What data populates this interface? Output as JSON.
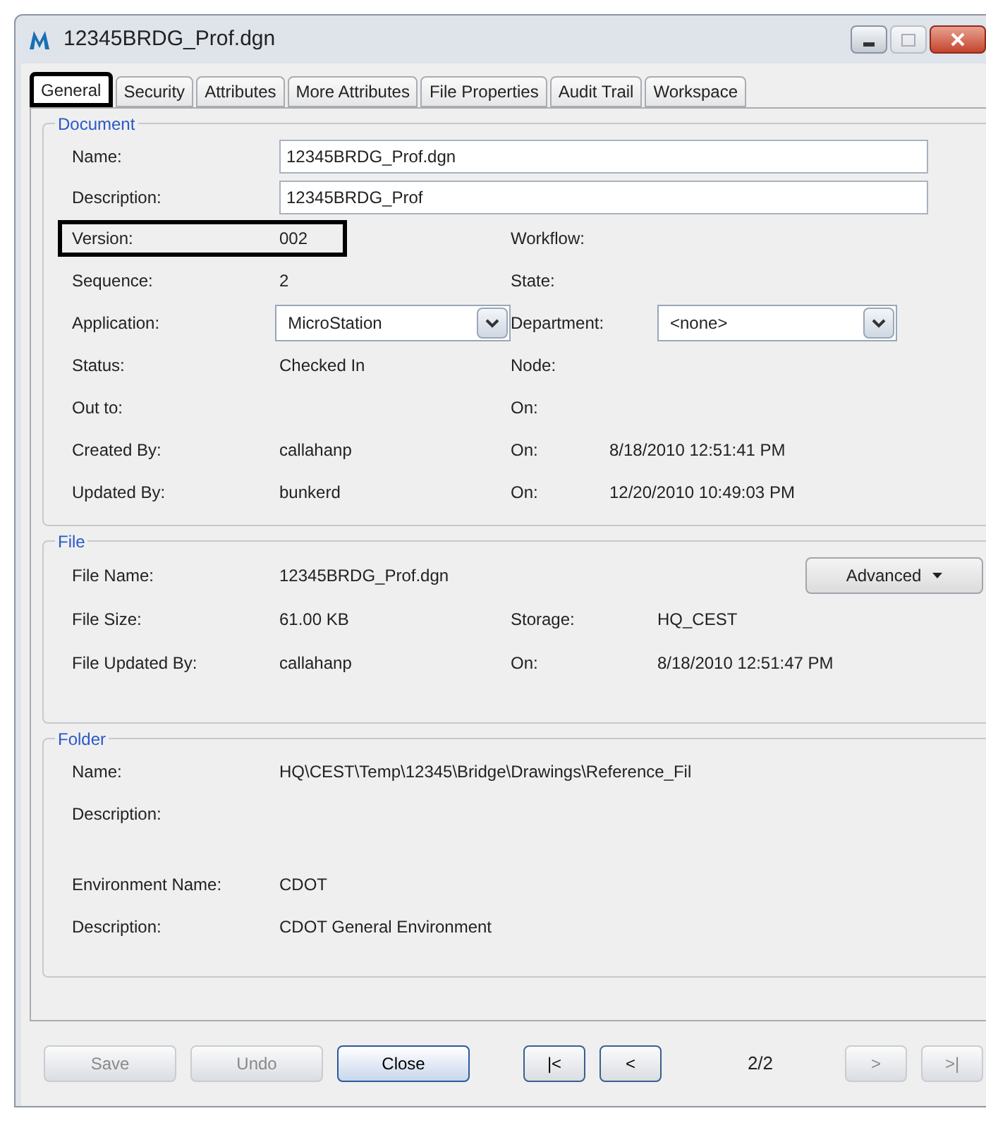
{
  "window": {
    "title": "12345BRDG_Prof.dgn"
  },
  "tabs": [
    {
      "label": "General",
      "selected": true,
      "highlighted": true
    },
    {
      "label": "Security",
      "selected": false,
      "highlighted": false
    },
    {
      "label": "Attributes",
      "selected": false,
      "highlighted": false
    },
    {
      "label": "More Attributes",
      "selected": false,
      "highlighted": false
    },
    {
      "label": "File Properties",
      "selected": false,
      "highlighted": false
    },
    {
      "label": "Audit Trail",
      "selected": false,
      "highlighted": false
    },
    {
      "label": "Workspace",
      "selected": false,
      "highlighted": false
    }
  ],
  "document": {
    "title": "Document",
    "inputs": [
      {
        "label": "Name:",
        "value": "12345BRDG_Prof.dgn"
      },
      {
        "label": "Description:",
        "value": "12345BRDG_Prof"
      }
    ],
    "rows": [
      {
        "left": {
          "label": "Version:",
          "value": "002",
          "kind": "text",
          "highlighted": true
        },
        "right": {
          "label": "Workflow:",
          "kind": "text"
        }
      },
      {
        "left": {
          "label": "Sequence:",
          "value": "2",
          "kind": "text",
          "highlighted": false
        },
        "right": {
          "label": "State:",
          "kind": "text"
        }
      },
      {
        "left": {
          "label": "Application:",
          "value": "MicroStation",
          "kind": "dropdown",
          "highlighted": false
        },
        "right": {
          "label": "Department:",
          "value": "<none>",
          "kind": "dropdown"
        }
      },
      {
        "left": {
          "label": "Status:",
          "value": "Checked In",
          "kind": "text",
          "highlighted": false
        },
        "right": {
          "label": "Node:",
          "kind": "text"
        }
      },
      {
        "left": {
          "label": "Out to:",
          "kind": "text",
          "highlighted": false
        },
        "right": {
          "label": "On:",
          "kind": "text"
        }
      },
      {
        "left": {
          "label": "Created By:",
          "value": "callahanp",
          "kind": "text",
          "highlighted": false
        },
        "right": {
          "label": "On:",
          "value": "8/18/2010 12:51:41 PM",
          "kind": "text"
        }
      },
      {
        "left": {
          "label": "Updated By:",
          "value": "bunkerd",
          "kind": "text",
          "highlighted": false
        },
        "right": {
          "label": "On:",
          "value": "12/20/2010 10:49:03 PM",
          "kind": "text"
        }
      }
    ]
  },
  "file": {
    "title": "File",
    "rows": [
      {
        "left": {
          "label": "File Name:",
          "value": "12345BRDG_Prof.dgn"
        },
        "right": {
          "kind": "button",
          "label": "Advanced"
        }
      },
      {
        "left": {
          "label": "File Size:",
          "value": "61.00 KB"
        },
        "right": {
          "kind": "text",
          "label": "Storage:",
          "value": "HQ_CEST"
        }
      },
      {
        "left": {
          "label": "File Updated By:",
          "value": "callahanp"
        },
        "right": {
          "kind": "text",
          "label": "On:",
          "value": "8/18/2010 12:51:47 PM"
        }
      }
    ]
  },
  "folder": {
    "title": "Folder",
    "sections": [
      [
        {
          "label": "Name:",
          "value": "HQ\\CEST\\Temp\\12345\\Bridge\\Drawings\\Reference_Fil"
        },
        {
          "label": "Description:"
        }
      ],
      [
        {
          "label": "Environment Name:",
          "value": "CDOT"
        },
        {
          "label": "Description:",
          "value": "CDOT General Environment"
        }
      ]
    ]
  },
  "footer": [
    {
      "kind": "button",
      "label": "Save",
      "disabled": true,
      "default": false
    },
    {
      "kind": "button",
      "label": "Undo",
      "disabled": true,
      "default": false
    },
    {
      "kind": "button",
      "label": "Close",
      "disabled": false,
      "default": true
    },
    {
      "kind": "button",
      "label": "|<",
      "disabled": false,
      "default": false
    },
    {
      "kind": "button",
      "label": "<",
      "disabled": false,
      "default": false
    },
    {
      "kind": "counter",
      "text": "2/2"
    },
    {
      "kind": "button",
      "label": ">",
      "disabled": true,
      "default": false
    },
    {
      "kind": "button",
      "label": ">|",
      "disabled": true,
      "default": false
    }
  ]
}
